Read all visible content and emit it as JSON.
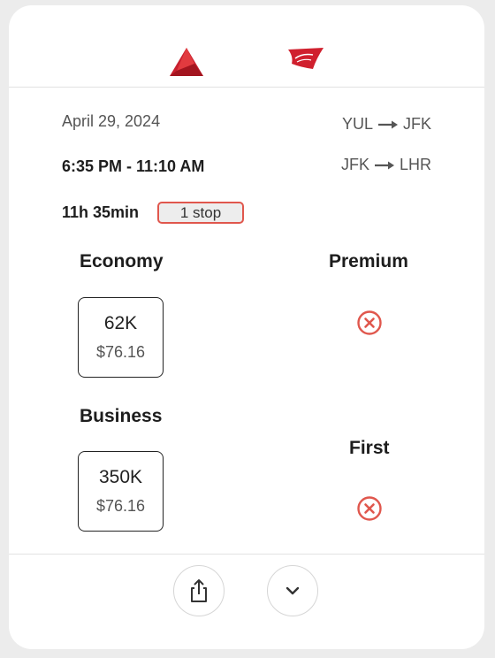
{
  "header": {
    "logos": [
      {
        "icon": "delta-logo-icon",
        "color": "#c8202f"
      },
      {
        "icon": "virgin-logo-icon",
        "color": "#d0202e"
      }
    ]
  },
  "flight": {
    "date": "April 29, 2024",
    "times": "6:35 PM - 11:10 AM",
    "duration": "11h 35min",
    "stops": "1 stop",
    "segments": [
      {
        "from": "YUL",
        "to": "JFK"
      },
      {
        "from": "JFK",
        "to": "LHR"
      }
    ]
  },
  "cabins": {
    "economy": {
      "title": "Economy",
      "points": "62K",
      "price": "$76.16"
    },
    "premium": {
      "title": "Premium"
    },
    "business": {
      "title": "Business",
      "points": "350K",
      "price": "$76.16"
    },
    "first": {
      "title": "First"
    }
  },
  "footer": {
    "buttons": [
      {
        "icon": "share-icon"
      },
      {
        "icon": "chevron-down-icon"
      }
    ]
  },
  "colors": {
    "accent_red": "#e0574d",
    "badge_bg": "#ededed"
  }
}
